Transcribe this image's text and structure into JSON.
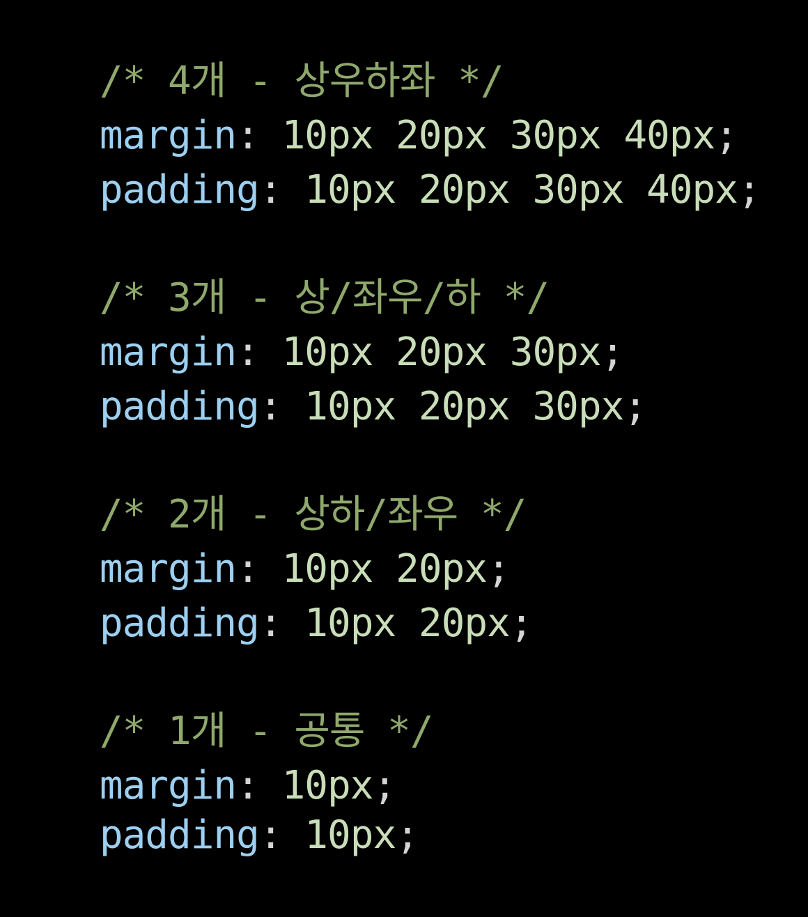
{
  "colors": {
    "background": "#000000",
    "comment": "#8fa86c",
    "property": "#9ccff0",
    "value": "#c8ddb8",
    "punctuation": "#d4d4d4"
  },
  "blocks": [
    {
      "comment": "/* 4개 - 상우하좌 */",
      "lines": [
        {
          "property": "margin",
          "colon": ":",
          "value": " 10px 20px 30px 40px",
          "semicolon": ";"
        },
        {
          "property": "padding",
          "colon": ":",
          "value": " 10px 20px 30px 40px",
          "semicolon": ";"
        }
      ]
    },
    {
      "comment": "/* 3개 - 상/좌우/하 */",
      "lines": [
        {
          "property": "margin",
          "colon": ":",
          "value": " 10px 20px 30px",
          "semicolon": ";"
        },
        {
          "property": "padding",
          "colon": ":",
          "value": " 10px 20px 30px",
          "semicolon": ";"
        }
      ]
    },
    {
      "comment": "/* 2개 - 상하/좌우 */",
      "lines": [
        {
          "property": "margin",
          "colon": ":",
          "value": " 10px 20px",
          "semicolon": ";"
        },
        {
          "property": "padding",
          "colon": ":",
          "value": " 10px 20px",
          "semicolon": ";"
        }
      ]
    },
    {
      "comment": "/* 1개 - 공통 */",
      "lines": [
        {
          "property": "margin",
          "colon": ":",
          "value": " 10px",
          "semicolon": ";"
        },
        {
          "property": "padding",
          "colon": ":",
          "value": " 10px",
          "semicolon": ";"
        }
      ]
    }
  ]
}
